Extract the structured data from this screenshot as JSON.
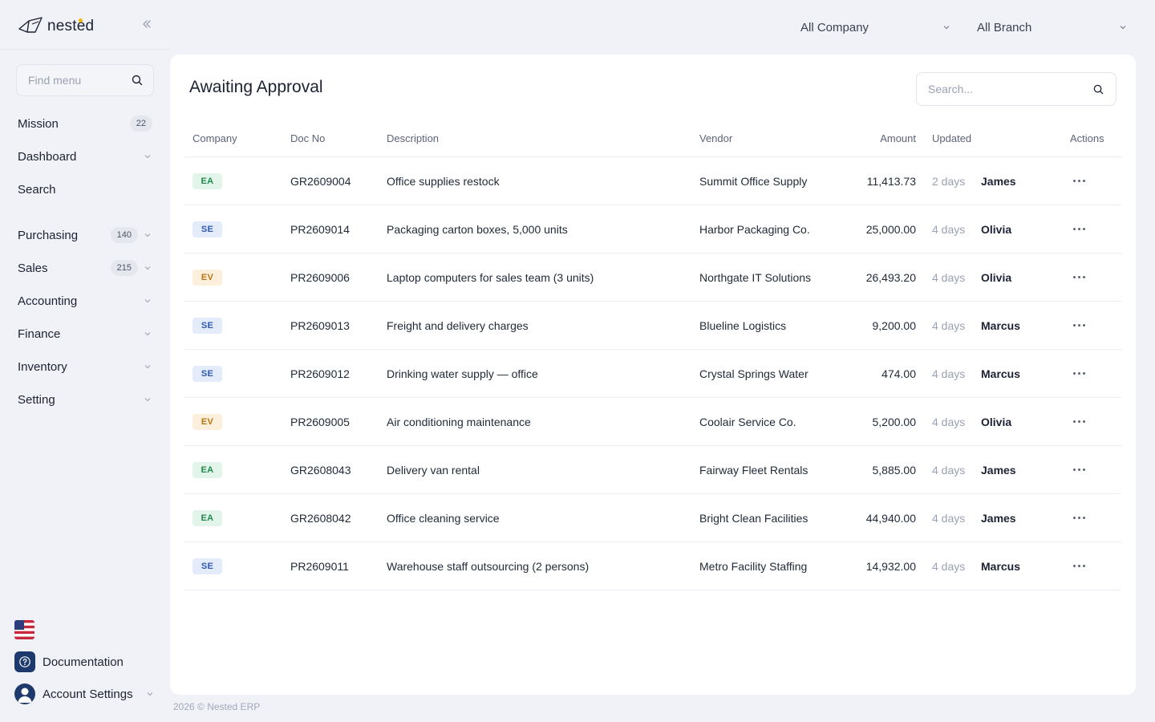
{
  "brand": {
    "name": "nested"
  },
  "sidebar": {
    "find_placeholder": "Find menu",
    "items": [
      {
        "label": "Mission",
        "badge": "22",
        "chevron": false
      },
      {
        "label": "Dashboard",
        "badge": "",
        "chevron": true
      },
      {
        "label": "Search",
        "badge": "",
        "chevron": false
      },
      {
        "label": "Purchasing",
        "badge": "140",
        "chevron": true
      },
      {
        "label": "Sales",
        "badge": "215",
        "chevron": true
      },
      {
        "label": "Accounting",
        "badge": "",
        "chevron": true
      },
      {
        "label": "Finance",
        "badge": "",
        "chevron": true
      },
      {
        "label": "Inventory",
        "badge": "",
        "chevron": true
      },
      {
        "label": "Setting",
        "badge": "",
        "chevron": true
      }
    ],
    "documentation": "Documentation",
    "account_settings": "Account Settings"
  },
  "header": {
    "company_select": "All Company",
    "branch_select": "All Branch"
  },
  "main": {
    "title": "Awaiting Approval",
    "search_placeholder": "Search...",
    "columns": {
      "company": "Company",
      "doc_no": "Doc No",
      "description": "Description",
      "vendor": "Vendor",
      "amount": "Amount",
      "updated": "Updated",
      "actions": "Actions"
    },
    "rows": [
      {
        "company": "EA",
        "doc_no": "GR2609004",
        "description": "Office supplies restock",
        "vendor": "Summit Office Supply",
        "amount": "11,413.73",
        "updated": "2 days",
        "user": "James"
      },
      {
        "company": "SE",
        "doc_no": "PR2609014",
        "description": "Packaging carton boxes, 5,000 units",
        "vendor": "Harbor Packaging Co.",
        "amount": "25,000.00",
        "updated": "4 days",
        "user": "Olivia"
      },
      {
        "company": "EV",
        "doc_no": "PR2609006",
        "description": "Laptop computers for sales team (3 units)",
        "vendor": "Northgate IT Solutions",
        "amount": "26,493.20",
        "updated": "4 days",
        "user": "Olivia"
      },
      {
        "company": "SE",
        "doc_no": "PR2609013",
        "description": "Freight and delivery charges",
        "vendor": "Blueline Logistics",
        "amount": "9,200.00",
        "updated": "4 days",
        "user": "Marcus"
      },
      {
        "company": "SE",
        "doc_no": "PR2609012",
        "description": "Drinking water supply — office",
        "vendor": "Crystal Springs Water",
        "amount": "474.00",
        "updated": "4 days",
        "user": "Marcus"
      },
      {
        "company": "EV",
        "doc_no": "PR2609005",
        "description": "Air conditioning maintenance",
        "vendor": "Coolair Service Co.",
        "amount": "5,200.00",
        "updated": "4 days",
        "user": "Olivia"
      },
      {
        "company": "EA",
        "doc_no": "GR2608043",
        "description": "Delivery van rental",
        "vendor": "Fairway Fleet Rentals",
        "amount": "5,885.00",
        "updated": "4 days",
        "user": "James"
      },
      {
        "company": "EA",
        "doc_no": "GR2608042",
        "description": "Office cleaning service",
        "vendor": "Bright Clean Facilities",
        "amount": "44,940.00",
        "updated": "4 days",
        "user": "James"
      },
      {
        "company": "SE",
        "doc_no": "PR2609011",
        "description": "Warehouse staff outsourcing (2 persons)",
        "vendor": "Metro Facility Staffing",
        "amount": "14,932.00",
        "updated": "4 days",
        "user": "Marcus"
      }
    ]
  },
  "footer": {
    "copyright": "2026 © Nested ERP"
  },
  "colors": {
    "background": "#f1f2f7",
    "card": "#ffffff",
    "primary_dark": "#1e3a6d",
    "logo_accent": "#f5b400",
    "tag_EA": "#1f8a4c",
    "tag_SE": "#2f59b8",
    "tag_EV": "#b9740e"
  }
}
